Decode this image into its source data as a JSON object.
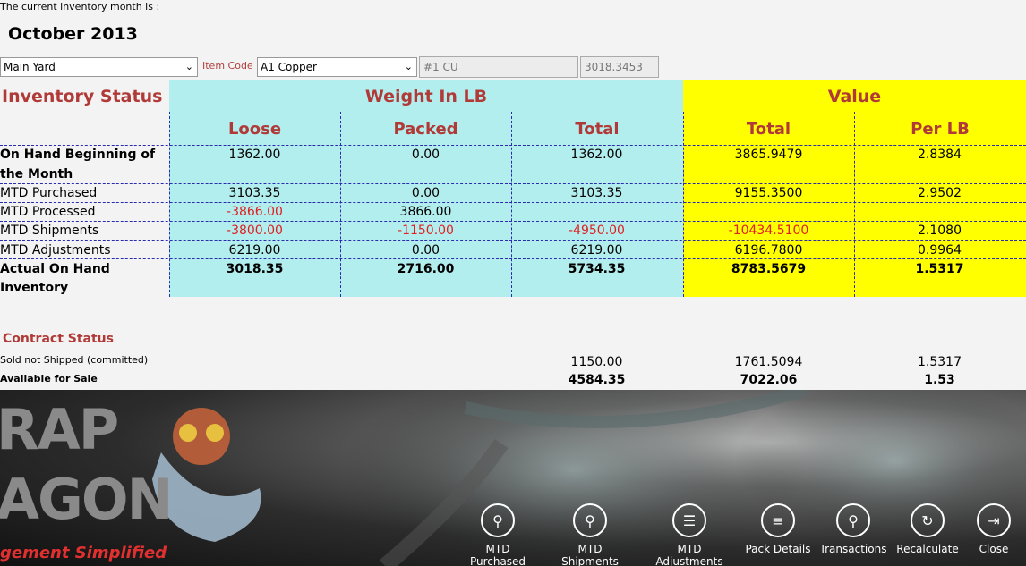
{
  "header": {
    "month_caption": "The current inventory month is :",
    "month_value": "October 2013"
  },
  "filters": {
    "yard_select": "Main Yard",
    "item_code_label": "Item Code",
    "item_select": "A1 Copper",
    "grade_field": "#1 CU",
    "price_field": "3018.3453"
  },
  "table": {
    "section_title": "Inventory Status",
    "weight_group": "Weight In LB",
    "value_group": "Value",
    "columns": [
      "Loose",
      "Packed",
      "Total",
      "Total",
      "Per LB"
    ],
    "rows": [
      {
        "label_l1": "On Hand Beginning of",
        "label_l2": "the Month",
        "cells": [
          "1362.00",
          "0.00",
          "1362.00",
          "3865.9479",
          "2.8384"
        ]
      },
      {
        "label": "MTD Purchased",
        "cells": [
          "3103.35",
          "0.00",
          "3103.35",
          "9155.3500",
          "2.9502"
        ]
      },
      {
        "label": "MTD Processed",
        "cells": [
          "-3866.00",
          "3866.00",
          "",
          "",
          ""
        ]
      },
      {
        "label": "MTD Shipments",
        "cells": [
          "-3800.00",
          "-1150.00",
          "-4950.00",
          "-10434.5100",
          "2.1080"
        ]
      },
      {
        "label": "MTD Adjustments",
        "cells": [
          "6219.00",
          "0.00",
          "6219.00",
          "6196.7800",
          "0.9964"
        ]
      },
      {
        "label_l1": "Actual On Hand",
        "label_l2": "Inventory",
        "cells": [
          "3018.35",
          "2716.00",
          "5734.35",
          "8783.5679",
          "1.5317"
        ]
      }
    ]
  },
  "contract": {
    "title": "Contract Status",
    "rows": [
      {
        "label": "Sold not Shipped (committed)",
        "cells": [
          "1150.00",
          "1761.5094",
          "1.5317"
        ]
      },
      {
        "label": "Available for Sale",
        "cells": [
          "4584.35",
          "7022.06",
          "1.53"
        ]
      }
    ]
  },
  "banner": {
    "logo_line1": "RAP",
    "logo_line2": "AGON",
    "tagline": "gement Simplified"
  },
  "buttons": [
    {
      "label": "MTD Purchased",
      "icon": "magnify-doc-icon"
    },
    {
      "label": "MTD Shipments",
      "icon": "magnify-doc-icon"
    },
    {
      "label": "MTD Adjustments",
      "icon": "list-icon"
    },
    {
      "label": "Pack Details",
      "icon": "list-lines-icon"
    },
    {
      "label": "Transactions",
      "icon": "magnify-doc-icon"
    },
    {
      "label": "Recalculate",
      "icon": "refresh-icon"
    },
    {
      "label": "Close",
      "icon": "exit-icon"
    }
  ],
  "colors": {
    "header_red": "#b03a37",
    "negative_red": "#e02020",
    "weight_bg": "#b3eeee",
    "value_bg": "#ffff00"
  }
}
